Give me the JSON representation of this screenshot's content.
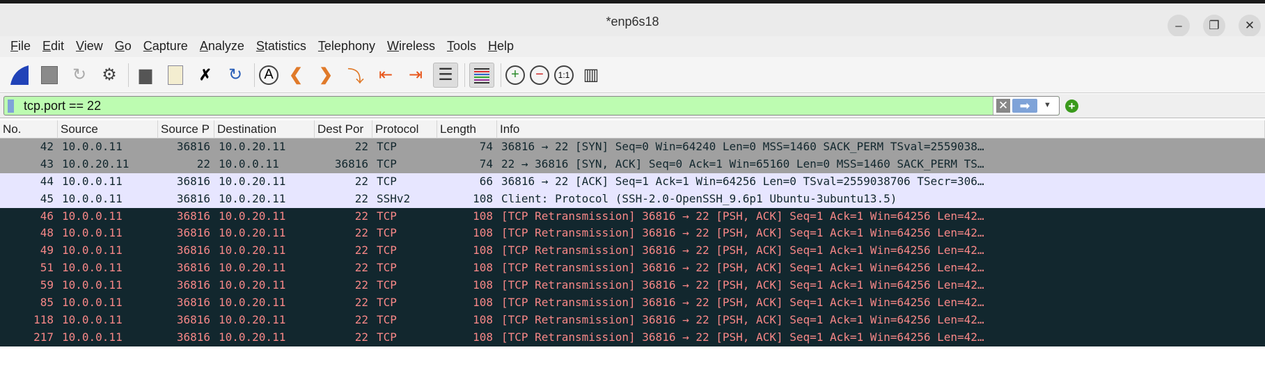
{
  "window": {
    "title": "*enp6s18",
    "minimize": "–",
    "restore": "❐",
    "close": "✕"
  },
  "menu": [
    "File",
    "Edit",
    "View",
    "Go",
    "Capture",
    "Analyze",
    "Statistics",
    "Telephony",
    "Wireless",
    "Tools",
    "Help"
  ],
  "toolbar": [
    "start-capture",
    "stop-capture",
    "restart-capture",
    "capture-options",
    "open-file",
    "save-file",
    "close-file",
    "reload-file",
    "find-packet",
    "go-back",
    "go-forward",
    "go-to-packet",
    "first-packet",
    "last-packet",
    "auto-scroll",
    "colorize",
    "zoom-in",
    "zoom-out",
    "normal-size",
    "resize-columns"
  ],
  "filter": {
    "value": "tcp.port == 22",
    "clear": "✕",
    "apply": "➡",
    "dropdown": "▼",
    "add": "+"
  },
  "columns": [
    "No.",
    "Source",
    "Source P",
    "Destination",
    "Dest Por",
    "Protocol",
    "Length",
    "Info"
  ],
  "colors": {
    "gray_bg": "#a0a0a0",
    "gray_fg": "#12272e",
    "lavender_bg": "#e7e6ff",
    "lavender_fg": "#12272e",
    "dark_bg": "#12272e",
    "dark_fg": "#f78787"
  },
  "packets": [
    {
      "no": "42",
      "src": "10.0.0.11",
      "sport": "36816",
      "dst": "10.0.20.11",
      "dport": "22",
      "proto": "TCP",
      "len": "74",
      "info": "36816 → 22 [SYN] Seq=0 Win=64240 Len=0 MSS=1460 SACK_PERM TSval=2559038…",
      "style": "gray"
    },
    {
      "no": "43",
      "src": "10.0.20.11",
      "sport": "22",
      "dst": "10.0.0.11",
      "dport": "36816",
      "proto": "TCP",
      "len": "74",
      "info": "22 → 36816 [SYN, ACK] Seq=0 Ack=1 Win=65160 Len=0 MSS=1460 SACK_PERM TS…",
      "style": "gray"
    },
    {
      "no": "44",
      "src": "10.0.0.11",
      "sport": "36816",
      "dst": "10.0.20.11",
      "dport": "22",
      "proto": "TCP",
      "len": "66",
      "info": "36816 → 22 [ACK] Seq=1 Ack=1 Win=64256 Len=0 TSval=2559038706 TSecr=306…",
      "style": "lavender"
    },
    {
      "no": "45",
      "src": "10.0.0.11",
      "sport": "36816",
      "dst": "10.0.20.11",
      "dport": "22",
      "proto": "SSHv2",
      "len": "108",
      "info": "Client: Protocol (SSH-2.0-OpenSSH_9.6p1 Ubuntu-3ubuntu13.5)",
      "style": "lavender"
    },
    {
      "no": "46",
      "src": "10.0.0.11",
      "sport": "36816",
      "dst": "10.0.20.11",
      "dport": "22",
      "proto": "TCP",
      "len": "108",
      "info": "[TCP Retransmission] 36816 → 22 [PSH, ACK] Seq=1 Ack=1 Win=64256 Len=42…",
      "style": "dark"
    },
    {
      "no": "48",
      "src": "10.0.0.11",
      "sport": "36816",
      "dst": "10.0.20.11",
      "dport": "22",
      "proto": "TCP",
      "len": "108",
      "info": "[TCP Retransmission] 36816 → 22 [PSH, ACK] Seq=1 Ack=1 Win=64256 Len=42…",
      "style": "dark"
    },
    {
      "no": "49",
      "src": "10.0.0.11",
      "sport": "36816",
      "dst": "10.0.20.11",
      "dport": "22",
      "proto": "TCP",
      "len": "108",
      "info": "[TCP Retransmission] 36816 → 22 [PSH, ACK] Seq=1 Ack=1 Win=64256 Len=42…",
      "style": "dark"
    },
    {
      "no": "51",
      "src": "10.0.0.11",
      "sport": "36816",
      "dst": "10.0.20.11",
      "dport": "22",
      "proto": "TCP",
      "len": "108",
      "info": "[TCP Retransmission] 36816 → 22 [PSH, ACK] Seq=1 Ack=1 Win=64256 Len=42…",
      "style": "dark"
    },
    {
      "no": "59",
      "src": "10.0.0.11",
      "sport": "36816",
      "dst": "10.0.20.11",
      "dport": "22",
      "proto": "TCP",
      "len": "108",
      "info": "[TCP Retransmission] 36816 → 22 [PSH, ACK] Seq=1 Ack=1 Win=64256 Len=42…",
      "style": "dark"
    },
    {
      "no": "85",
      "src": "10.0.0.11",
      "sport": "36816",
      "dst": "10.0.20.11",
      "dport": "22",
      "proto": "TCP",
      "len": "108",
      "info": "[TCP Retransmission] 36816 → 22 [PSH, ACK] Seq=1 Ack=1 Win=64256 Len=42…",
      "style": "dark"
    },
    {
      "no": "118",
      "src": "10.0.0.11",
      "sport": "36816",
      "dst": "10.0.20.11",
      "dport": "22",
      "proto": "TCP",
      "len": "108",
      "info": "[TCP Retransmission] 36816 → 22 [PSH, ACK] Seq=1 Ack=1 Win=64256 Len=42…",
      "style": "dark"
    },
    {
      "no": "217",
      "src": "10.0.0.11",
      "sport": "36816",
      "dst": "10.0.20.11",
      "dport": "22",
      "proto": "TCP",
      "len": "108",
      "info": "[TCP Retransmission] 36816 → 22 [PSH, ACK] Seq=1 Ack=1 Win=64256 Len=42…",
      "style": "dark"
    }
  ]
}
